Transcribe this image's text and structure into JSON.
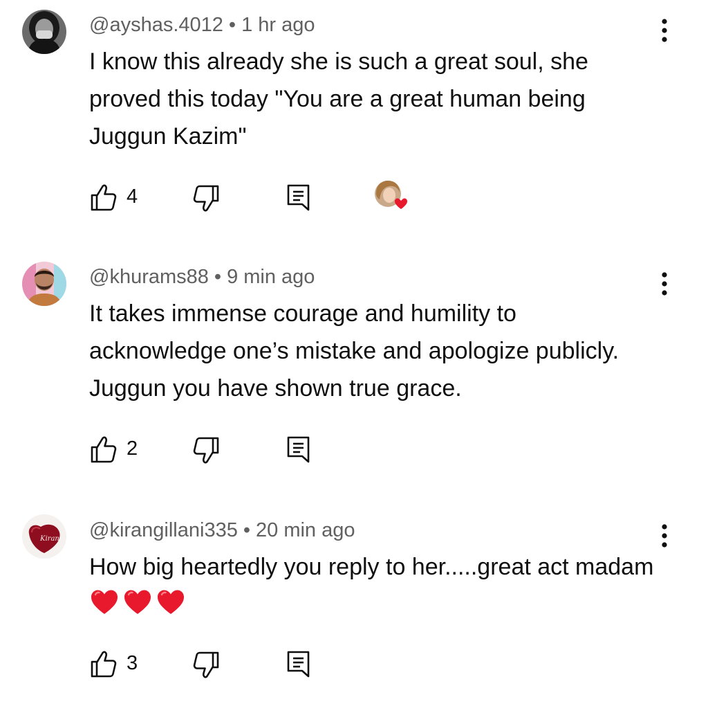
{
  "comments": [
    {
      "handle": "@ayshas.4012",
      "separator": "•",
      "time": "1 hr ago",
      "text": "I know this already she is such a great soul, she proved this today \"You are a great human being Juggun Kazim\"",
      "likes": "4",
      "hearted_by_creator": true,
      "avatar_icon": "avatar-woman-masked"
    },
    {
      "handle": "@khurams88",
      "separator": "•",
      "time": "9 min ago",
      "text": "It takes immense courage and humility to acknowledge one’s mistake and apologize publicly. Juggun you have shown true grace.",
      "likes": "2",
      "hearted_by_creator": false,
      "avatar_icon": "avatar-man-beard"
    },
    {
      "handle": "@kirangillani335",
      "separator": "•",
      "time": "20 min ago",
      "text": "How big heartedly you reply to her.....great act madam",
      "emoji": "❤️❤️❤️",
      "likes": "3",
      "hearted_by_creator": false,
      "avatar_icon": "avatar-red-heart-logo"
    }
  ],
  "icons": {
    "like": "thumbs-up-icon",
    "dislike": "thumbs-down-icon",
    "reply": "reply-icon",
    "more": "more-vertical-icon"
  },
  "colors": {
    "meta_text": "#606060",
    "body_text": "#0f0f0f",
    "heart_red": "#e8192c"
  }
}
